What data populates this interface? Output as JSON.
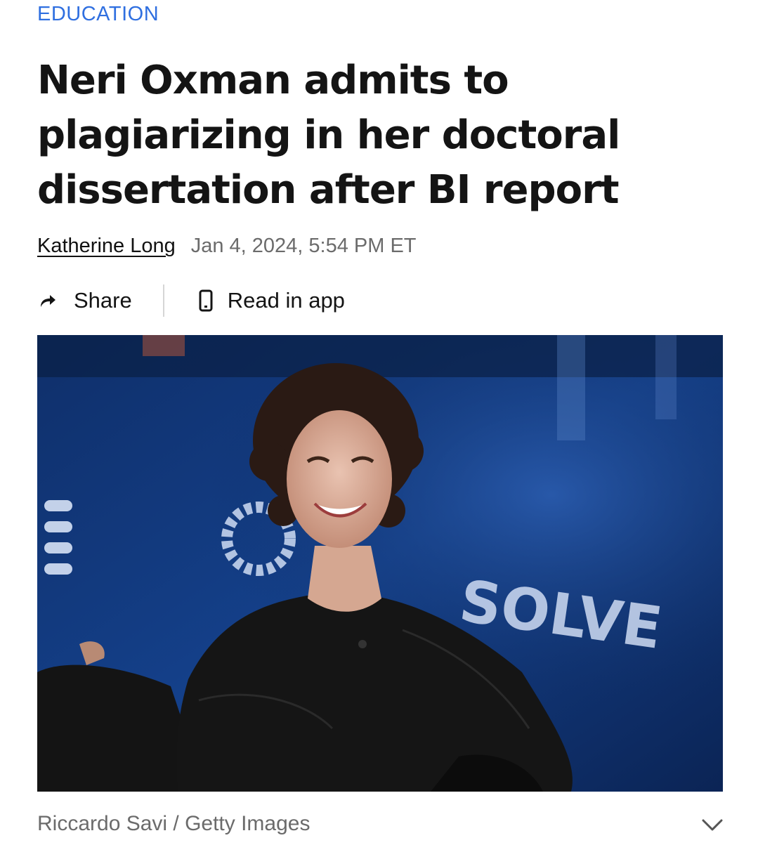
{
  "article": {
    "category": "EDUCATION",
    "headline": "Neri Oxman admits to plagiarizing in her doctoral dissertation after BI report",
    "author": "Katherine Long",
    "timestamp": "Jan 4, 2024, 5:54 PM ET"
  },
  "actions": {
    "share_label": "Share",
    "read_in_app_label": "Read in app"
  },
  "photo": {
    "stage_text": "SOLVE",
    "caption": "Riccardo Savi / Getty Images",
    "expand_icon": "chevron-down-icon"
  },
  "colors": {
    "category_link": "#2f6fe0",
    "headline": "#141414",
    "meta_gray": "#6b6b6b",
    "stage_backdrop": "#0d2a5e"
  }
}
